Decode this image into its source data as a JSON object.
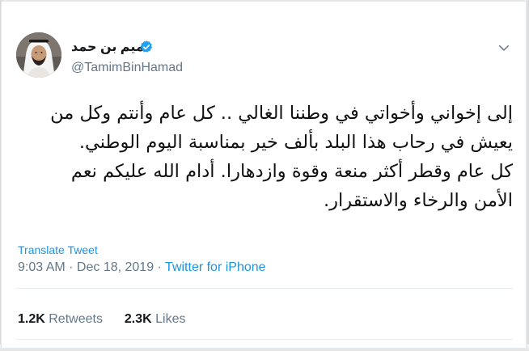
{
  "author": {
    "display_name": "تميم بن حمد",
    "handle": "@TamimBinHamad",
    "verified": true,
    "avatar": "profile-photo"
  },
  "tweet": {
    "lines": [
      "إلى إخواني وأخواتي في وطننا الغالي .. كل عام وأنتم وكل من",
      "يعيش في رحاب هذا البلد بألف خير بمناسبة اليوم الوطني.",
      "كل عام وقطر أكثر منعة وقوة وازدهارا. أدام الله عليكم نعم",
      "الأمن والرخاء والاستقرار."
    ],
    "translate_label": "Translate Tweet",
    "time": "9:03 AM",
    "separator": " · ",
    "date": "Dec 18, 2019",
    "source": "Twitter for iPhone"
  },
  "stats": {
    "retweets_count": "1.2K",
    "retweets_label": "Retweets",
    "likes_count": "2.3K",
    "likes_label": "Likes"
  },
  "icons": {
    "verified": "verified-badge-icon",
    "menu": "chevron-down-icon"
  },
  "colors": {
    "link": "#1b95e0",
    "verified": "#1da1f2",
    "muted": "#657786",
    "text": "#14171a"
  }
}
